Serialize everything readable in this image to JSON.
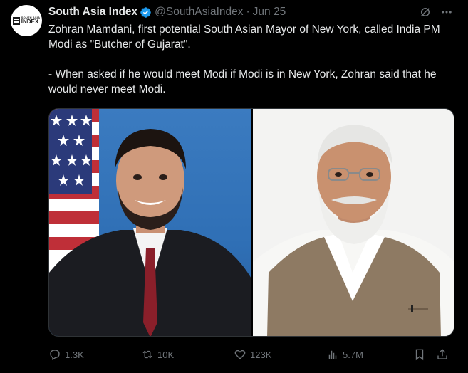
{
  "tweet": {
    "author_name": "South Asia Index",
    "author_handle": "@SouthAsiaIndex",
    "separator": "·",
    "date": "Jun 25",
    "avatar_logo_small": "SOUTH ASIA",
    "avatar_logo_big": "INDEX",
    "text_line1": "Zohran Mamdani, first potential South Asian Mayor of New York, called India PM Modi as \"Butcher of Gujarat\".",
    "text_line2": "- When asked if he would meet Modi if Modi is in New York, Zohran said that he would never meet Modi.",
    "media": [
      {
        "subject": "man in dark suit and red tie before US flag and blue background"
      },
      {
        "subject": "man with white beard in beige vest over white kurta"
      }
    ],
    "metrics": {
      "replies": "1.3K",
      "reposts": "10K",
      "likes": "123K",
      "views": "5.7M"
    }
  },
  "colors": {
    "background": "#000000",
    "text": "#e7e9ea",
    "muted": "#71767b",
    "verified": "#1d9bf0"
  }
}
